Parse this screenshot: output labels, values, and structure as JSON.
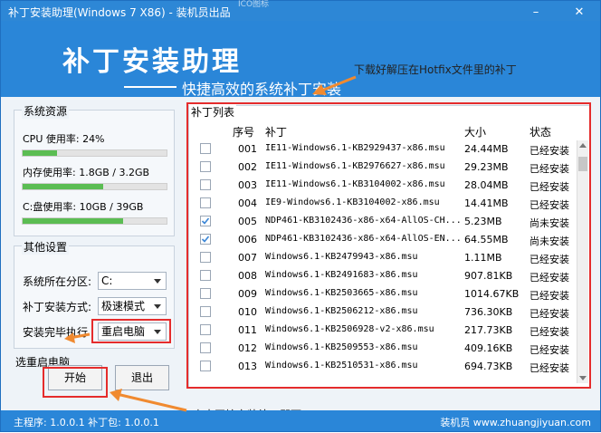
{
  "window": {
    "title": "补丁安装助理(Windows 7 X86) - 装机员出品",
    "faint_text": "ICO图标",
    "minimize_glyph": "–",
    "close_glyph": "✕"
  },
  "banner": {
    "title": "补丁安装助理",
    "subtitle": "快捷高效的系统补丁安装",
    "annotation_top": "下载好解压在Hotfix文件里的补丁"
  },
  "resources": {
    "group_title": "系统资源",
    "items": [
      {
        "label": "CPU 使用率: 24%",
        "percent": 24
      },
      {
        "label": "内存使用率: 1.8GB / 3.2GB",
        "percent": 56
      },
      {
        "label": "C:盘使用率: 10GB / 39GB",
        "percent": 70
      }
    ]
  },
  "settings": {
    "group_title": "其他设置",
    "partition_label": "系统所在分区:",
    "partition_value": "C:",
    "mode_label": "补丁安装方式:",
    "mode_value": "极速模式",
    "after_label": "安装完毕执行",
    "after_value": "重启电脑",
    "after_note": "选重启电脑"
  },
  "buttons": {
    "start": "开始",
    "exit": "退出"
  },
  "list": {
    "title": "补丁列表",
    "headers": {
      "index": "序号",
      "patch": "补丁",
      "size": "大小",
      "status": "状态"
    },
    "rows": [
      {
        "checked": false,
        "index": "001",
        "patch": "IE11-Windows6.1-KB2929437-x86.msu",
        "size": "24.44MB",
        "status": "已经安装"
      },
      {
        "checked": false,
        "index": "002",
        "patch": "IE11-Windows6.1-KB2976627-x86.msu",
        "size": "29.23MB",
        "status": "已经安装"
      },
      {
        "checked": false,
        "index": "003",
        "patch": "IE11-Windows6.1-KB3104002-x86.msu",
        "size": "28.04MB",
        "status": "已经安装"
      },
      {
        "checked": false,
        "index": "004",
        "patch": "IE9-Windows6.1-KB3104002-x86.msu",
        "size": "14.41MB",
        "status": "已经安装"
      },
      {
        "checked": true,
        "index": "005",
        "patch": "NDP461-KB3102436-x86-x64-AllOS-CH...",
        "size": "5.23MB",
        "status": "尚未安装"
      },
      {
        "checked": true,
        "index": "006",
        "patch": "NDP461-KB3102436-x86-x64-AllOS-EN...",
        "size": "64.55MB",
        "status": "尚未安装"
      },
      {
        "checked": false,
        "index": "007",
        "patch": "Windows6.1-KB2479943-x86.msu",
        "size": "1.11MB",
        "status": "已经安装"
      },
      {
        "checked": false,
        "index": "008",
        "patch": "Windows6.1-KB2491683-x86.msu",
        "size": "907.81KB",
        "status": "已经安装"
      },
      {
        "checked": false,
        "index": "009",
        "patch": "Windows6.1-KB2503665-x86.msu",
        "size": "1014.67KB",
        "status": "已经安装"
      },
      {
        "checked": false,
        "index": "010",
        "patch": "Windows6.1-KB2506212-x86.msu",
        "size": "736.30KB",
        "status": "已经安装"
      },
      {
        "checked": false,
        "index": "011",
        "patch": "Windows6.1-KB2506928-v2-x86.msu",
        "size": "217.73KB",
        "status": "已经安装"
      },
      {
        "checked": false,
        "index": "012",
        "patch": "Windows6.1-KB2509553-x86.msu",
        "size": "409.16KB",
        "status": "已经安装"
      },
      {
        "checked": false,
        "index": "013",
        "patch": "Windows6.1-KB2510531-x86.msu",
        "size": "694.73KB",
        "status": "已经安装"
      }
    ]
  },
  "annotation_bottom": "点击开始安装补丁即可",
  "status": {
    "left": "主程序: 1.0.0.1  补丁包: 1.0.0.1",
    "right": "装机员 www.zhuangjiyuan.com"
  },
  "colors": {
    "accent": "#2a86d8",
    "highlight": "#e52c2c",
    "arrow": "#f08a30",
    "check": "#3b86d6"
  }
}
